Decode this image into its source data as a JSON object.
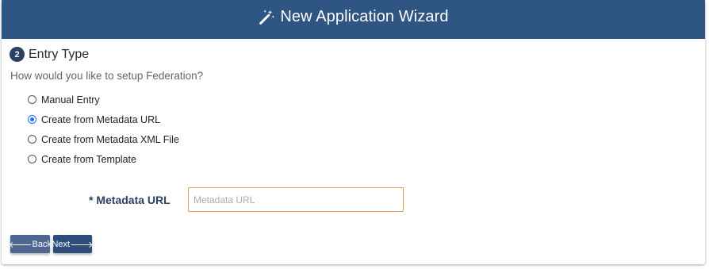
{
  "header": {
    "icon": "magic-wand-icon",
    "title": "New Application Wizard",
    "background": "#2f5582"
  },
  "step": {
    "number": "2",
    "title": "Entry Type"
  },
  "question": "How would you like to setup Federation?",
  "options": [
    {
      "label": "Manual Entry",
      "checked": false
    },
    {
      "label": "Create from Metadata URL",
      "checked": true
    },
    {
      "label": "Create from Metadata XML File",
      "checked": false
    },
    {
      "label": "Create from Template",
      "checked": false
    }
  ],
  "metadata_url": {
    "label": "* Metadata URL",
    "placeholder": "Metadata URL",
    "value": ""
  },
  "buttons": {
    "back": {
      "icon": "arrow-left-icon",
      "arrow": "🡐",
      "label": "Back"
    },
    "next": {
      "icon": "arrow-right-icon",
      "arrow": "🡒",
      "label": "Next"
    }
  }
}
